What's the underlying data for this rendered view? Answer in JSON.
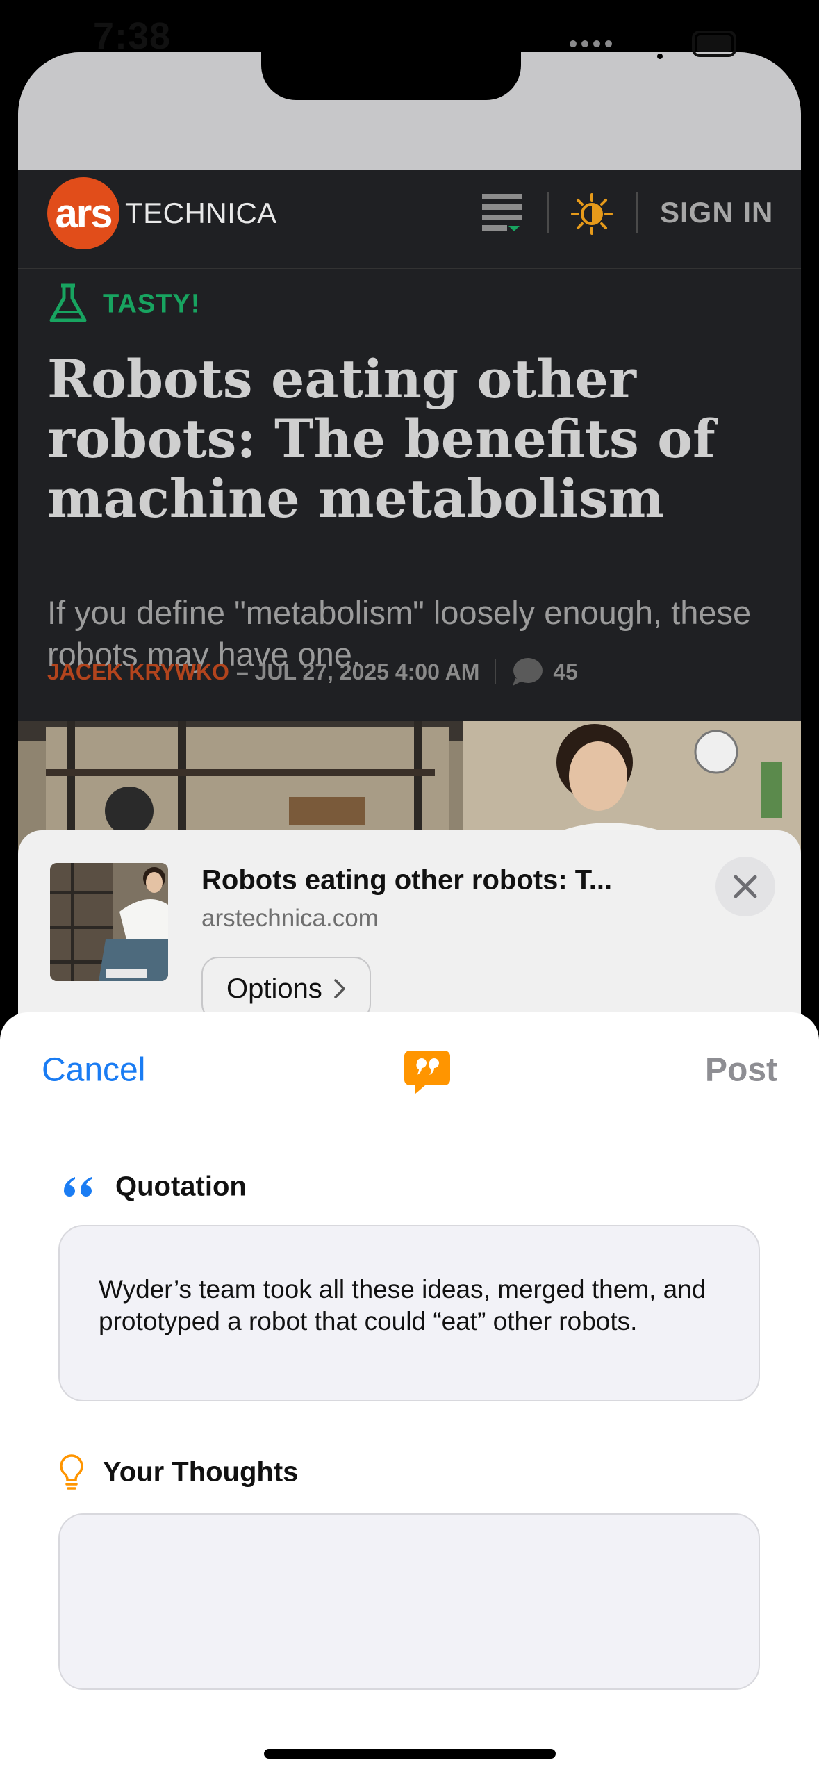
{
  "status_bar": {
    "time": "7:38"
  },
  "site": {
    "logo_mark": "ars",
    "logo_word": "TECHNICA",
    "sign_in": "SIGN IN",
    "menu_icon": "hamburger-menu-icon",
    "theme_icon": "sun-icon"
  },
  "article": {
    "section": "TASTY!",
    "headline": "Robots eating other robots: The benefits of machine metabolism",
    "dek": "If you define \"metabolism\" loosely enough, these robots may have one.",
    "author": "JACEK KRYWKO",
    "date": "– JUL 27, 2025 4:00 AM",
    "comment_count": "45"
  },
  "preview": {
    "title": "Robots eating other robots: T...",
    "domain": "arstechnica.com",
    "options_label": "Options"
  },
  "compose": {
    "cancel_label": "Cancel",
    "post_label": "Post",
    "quotation_label": "Quotation",
    "quotation_text": "Wyder’s team took all these ideas, merged them, and prototyped a robot that could “eat” other robots.",
    "thoughts_label": "Your Thoughts",
    "thoughts_value": ""
  },
  "colors": {
    "accent_blue": "#1a7cf3",
    "ars_orange": "#e14d1a",
    "section_green": "#18a460",
    "quote_orange": "#ff9500"
  }
}
